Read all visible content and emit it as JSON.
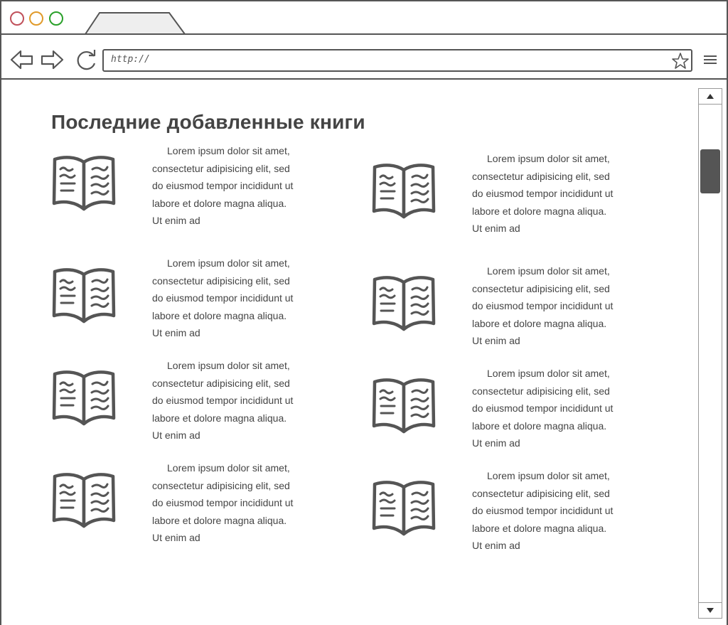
{
  "browser": {
    "url": "http://",
    "window_buttons": [
      "close",
      "minimize",
      "maximize"
    ],
    "colors": {
      "close": "#c0505a",
      "minimize": "#e09a2a",
      "maximize": "#2aa02a"
    }
  },
  "page": {
    "title": "Последние добавленные книги",
    "books": [
      {
        "description": "Lorem ipsum dolor sit amet, consectetur adipisicing elit, sed do eiusmod tempor incididunt ut labore et dolore magna aliqua. Ut enim ad"
      },
      {
        "description": "Lorem ipsum dolor sit amet, consectetur adipisicing elit, sed do eiusmod tempor incididunt ut labore et dolore magna aliqua. Ut enim ad"
      },
      {
        "description": "Lorem ipsum dolor sit amet, consectetur adipisicing elit, sed do eiusmod tempor incididunt ut labore et dolore magna aliqua. Ut enim ad"
      },
      {
        "description": "Lorem ipsum dolor sit amet, consectetur adipisicing elit, sed do eiusmod tempor incididunt ut labore et dolore magna aliqua. Ut enim ad"
      },
      {
        "description": "Lorem ipsum dolor sit amet, consectetur adipisicing elit, sed do eiusmod tempor incididunt ut labore et dolore magna aliqua. Ut enim ad"
      },
      {
        "description": "Lorem ipsum dolor sit amet, consectetur adipisicing elit, sed do eiusmod tempor incididunt ut labore et dolore magna aliqua. Ut enim ad"
      },
      {
        "description": "Lorem ipsum dolor sit amet, consectetur adipisicing elit, sed do eiusmod tempor incididunt ut labore et dolore magna aliqua. Ut enim ad"
      },
      {
        "description": "Lorem ipsum dolor sit amet, consectetur adipisicing elit, sed do eiusmod tempor incididunt ut labore et dolore magna aliqua. Ut enim ad"
      }
    ]
  },
  "icons": {
    "back": "back-arrow-icon",
    "forward": "forward-arrow-icon",
    "reload": "reload-icon",
    "bookmark": "star-icon",
    "menu": "hamburger-menu-icon",
    "book": "open-book-icon"
  }
}
